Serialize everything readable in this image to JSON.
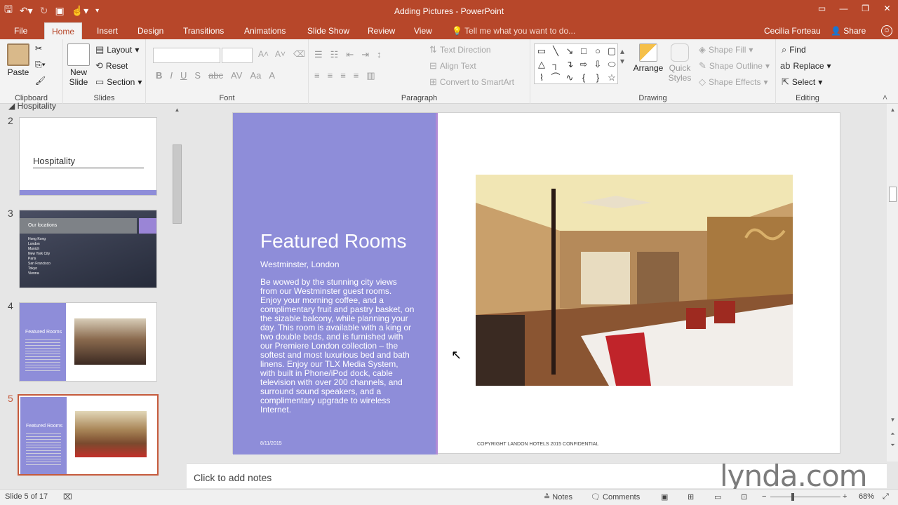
{
  "window": {
    "title": "Adding Pictures - PowerPoint"
  },
  "tabs": [
    "File",
    "Home",
    "Insert",
    "Design",
    "Transitions",
    "Animations",
    "Slide Show",
    "Review",
    "View"
  ],
  "tell_me": "Tell me what you want to do...",
  "user": "Cecilia Forteau",
  "share": "Share",
  "ribbon": {
    "clipboard": {
      "label": "Clipboard",
      "paste": "Paste"
    },
    "slides": {
      "label": "Slides",
      "new_slide": "New Slide",
      "layout": "Layout",
      "reset": "Reset",
      "section": "Section"
    },
    "font": {
      "label": "Font"
    },
    "paragraph": {
      "label": "Paragraph",
      "text_direction": "Text Direction",
      "align_text": "Align Text",
      "convert": "Convert to SmartArt"
    },
    "drawing": {
      "label": "Drawing",
      "arrange": "Arrange",
      "quick_styles": "Quick Styles",
      "shape_fill": "Shape Fill",
      "shape_outline": "Shape Outline",
      "shape_effects": "Shape Effects"
    },
    "editing": {
      "label": "Editing",
      "find": "Find",
      "replace": "Replace",
      "select": "Select"
    }
  },
  "panel": {
    "section_name": "Hospitality",
    "thumbs": [
      {
        "num": "2",
        "title": "Hospitality"
      },
      {
        "num": "3",
        "title": "Our locations",
        "items": [
          "Hong Kong",
          "London",
          "Munich",
          "New York City",
          "Paris",
          "San Francisco",
          "Tokyo",
          "Vienna"
        ]
      },
      {
        "num": "4",
        "title": "Featured Rooms"
      },
      {
        "num": "5",
        "title": "Featured Rooms"
      }
    ]
  },
  "slide": {
    "title": "Featured Rooms",
    "subtitle": "Westminster, London",
    "body": "Be wowed by the stunning city views from our Westminster guest rooms. Enjoy your morning coffee, and a complimentary fruit and pastry basket, on the sizable balcony, while planning your day. This room is available with a king or two double beds, and is furnished with our Premiere London collection – the softest and most luxurious bed and bath linens. Enjoy our TLX Media System, with built in Phone/iPod dock, cable television with over 200 channels, and surround sound speakers, and a complimentary upgrade to wireless Internet.",
    "date": "8/11/2015",
    "footer": "COPYRIGHT LANDON HOTELS 2015 CONFIDENTIAL"
  },
  "notes": {
    "placeholder": "Click to add notes"
  },
  "status": {
    "slide_info": "Slide 5 of 17",
    "notes": "Notes",
    "comments": "Comments",
    "zoom": "68%"
  },
  "watermark": "lynda.com",
  "colors": {
    "accent": "#b7472a",
    "slide_purple": "#8e8dd9"
  }
}
